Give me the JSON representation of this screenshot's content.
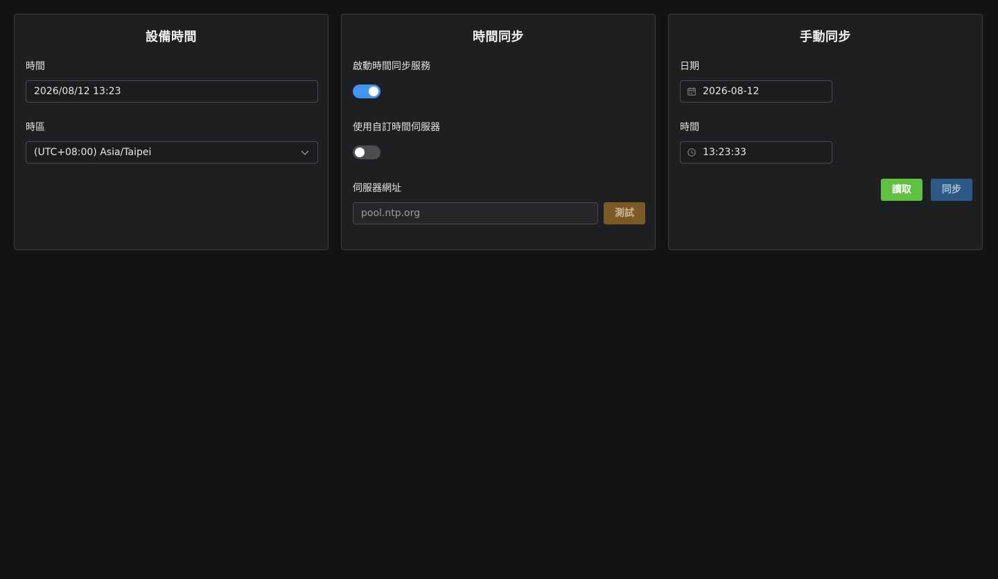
{
  "device_time": {
    "title": "設備時間",
    "time_label": "時間",
    "time_value": "2026/08/12 13:23",
    "timezone_label": "時區",
    "timezone_value": "(UTC+08:00) Asia/Taipei"
  },
  "time_sync": {
    "title": "時間同步",
    "enable_label": "啟動時間同步服務",
    "enable_on": true,
    "custom_server_label": "使用自訂時間伺服器",
    "custom_server_on": false,
    "server_label": "伺服器網址",
    "server_value": "pool.ntp.org",
    "test_button": "測試"
  },
  "manual_sync": {
    "title": "手動同步",
    "date_label": "日期",
    "date_value": "2026-08-12",
    "time_label": "時間",
    "time_value": "13:23:33",
    "read_button": "讀取",
    "sync_button": "同步"
  },
  "colors": {
    "page_bg": "#131313",
    "card_bg": "#1e1f21",
    "toggle_on": "#3f96f4",
    "read_button": "#5fc140",
    "sync_button": "#2d5986",
    "test_button": "#7c5a25"
  },
  "icons": {
    "timezone_select": "chevron-down-icon",
    "date_picker": "calendar-icon",
    "time_picker": "clock-icon"
  }
}
